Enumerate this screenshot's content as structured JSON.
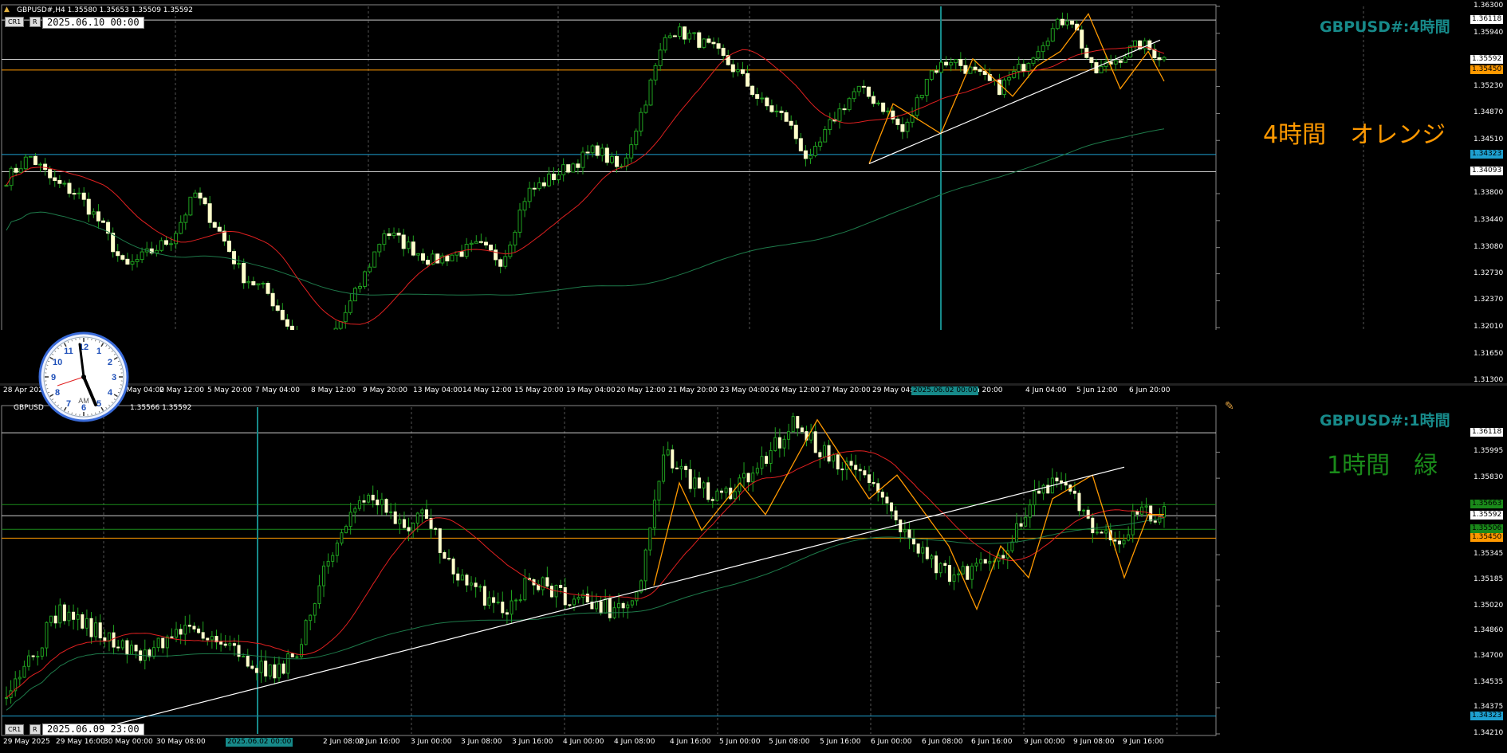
{
  "window": {
    "top": {
      "header": "GBPUSD#,H4  1.35580 1.35653 1.35509 1.35592",
      "btn1": "CR1",
      "btn2": "R",
      "date_box": "2025.06.10 00:00",
      "title": "GBPUSD#:4時間",
      "big_label": "4時間　オレンジ",
      "big_label_color": "#ff9900",
      "highlight_time": "2025.06.02 00:00"
    },
    "bottom": {
      "header": "GBPUSD",
      "header_tail": "1.35566 1.35592",
      "btn1": "CR1",
      "btn2": "R",
      "date_box": "2025.06.09 23:00",
      "title": "GBPUSD#:1時間",
      "big_label": "1時間　緑",
      "big_label_color": "#1a8a1a",
      "highlight_time": "2025.06.02 00:00"
    },
    "clock": {
      "am_label": "AM",
      "numbers": [
        "12",
        "1",
        "2",
        "3",
        "4",
        "5",
        "6",
        "7",
        "8",
        "9",
        "10",
        "11"
      ]
    }
  },
  "chart_data": [
    {
      "type": "candlestick",
      "symbol": "GBPUSD#",
      "timeframe": "H4",
      "ohlc_last": {
        "open": 1.3558,
        "high": 1.35653,
        "low": 1.35509,
        "close": 1.35592
      },
      "ylim": [
        1.313,
        1.363
      ],
      "price_ticks": [
        "1.36300",
        "1.35940",
        "1.35230",
        "1.34870",
        "1.34510",
        "1.33800",
        "1.33440",
        "1.33080",
        "1.32730",
        "1.32370",
        "1.32010",
        "1.31650",
        "1.31300"
      ],
      "x_ticks": [
        "28 Apr 2025",
        "2 May 04:00",
        "2 May 12:00",
        "5 May 20:00",
        "7 May 04:00",
        "8 May 12:00",
        "9 May 20:00",
        "13 May 04:00",
        "14 May 12:00",
        "15 May 20:00",
        "19 May 04:00",
        "20 May 12:00",
        "21 May 20:00",
        "23 May 04:00",
        "26 May 12:00",
        "27 May 20:00",
        "29 May 04:00",
        "2 Jun 20:00",
        "4 Jun 04:00",
        "5 Jun 12:00",
        "6 Jun 20:00"
      ],
      "levels": [
        {
          "value": 1.36118,
          "label": "1.36118",
          "color": "#cccccc"
        },
        {
          "value": 1.35592,
          "label": "1.35592",
          "color": "#cccccc"
        },
        {
          "value": 1.3545,
          "label": "1.35450",
          "color": "#ff9900"
        },
        {
          "value": 1.34323,
          "label": "1.34323",
          "color": "#1ea0d0"
        },
        {
          "value": 1.34093,
          "label": "1.34093",
          "color": "#cccccc"
        }
      ],
      "ma_fast_color": "#e02020",
      "ma_slow_color": "#1e7a4a",
      "zigzag_color": "#ff9900"
    },
    {
      "type": "candlestick",
      "symbol": "GBPUSD#",
      "timeframe": "H1",
      "ylim": [
        1.3421,
        1.3628
      ],
      "price_ticks": [
        "1.35995",
        "1.35830",
        "1.35345",
        "1.35185",
        "1.35020",
        "1.34860",
        "1.34700",
        "1.34535",
        "1.34375",
        "1.34210"
      ],
      "x_ticks": [
        "29 May 2025",
        "29 May 16:00",
        "30 May 00:00",
        "30 May 08:00",
        "2 Jun 08:00",
        "2 Jun 16:00",
        "3 Jun 00:00",
        "3 Jun 08:00",
        "3 Jun 16:00",
        "4 Jun 00:00",
        "4 Jun 08:00",
        "4 Jun 16:00",
        "5 Jun 00:00",
        "5 Jun 08:00",
        "5 Jun 16:00",
        "6 Jun 00:00",
        "6 Jun 08:00",
        "6 Jun 16:00",
        "9 Jun 00:00",
        "9 Jun 08:00",
        "9 Jun 16:00"
      ],
      "levels": [
        {
          "value": 1.36118,
          "label": "1.36118",
          "color": "#cccccc"
        },
        {
          "value": 1.35663,
          "label": "1.35663",
          "color": "#1a8a1a"
        },
        {
          "value": 1.35592,
          "label": "1.35592",
          "color": "#cccccc"
        },
        {
          "value": 1.35506,
          "label": "1.35506",
          "color": "#1a8a1a"
        },
        {
          "value": 1.3545,
          "label": "1.35450",
          "color": "#ff9900"
        },
        {
          "value": 1.34323,
          "label": "1.34323",
          "color": "#1ea0d0"
        }
      ],
      "ma_fast_color": "#e02020",
      "ma_slow_color": "#1e7a4a",
      "zigzag_color": "#ff9900"
    }
  ]
}
